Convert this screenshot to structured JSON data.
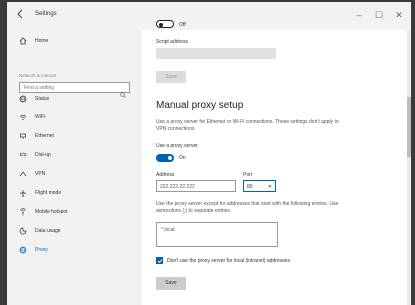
{
  "window": {
    "title": "Settings",
    "controls": {
      "minimize": "–",
      "maximize": "☐",
      "close": "✕"
    }
  },
  "sidebar": {
    "home_label": "Home",
    "search_placeholder": "Find a setting",
    "section_label": "Network & Internet",
    "items": [
      {
        "label": "Status",
        "icon": "globe-icon"
      },
      {
        "label": "WiFi",
        "icon": "wifi-icon"
      },
      {
        "label": "Ethernet",
        "icon": "ethernet-icon"
      },
      {
        "label": "Dial-up",
        "icon": "dialup-icon"
      },
      {
        "label": "VPN",
        "icon": "vpn-icon"
      },
      {
        "label": "Flight mode",
        "icon": "airplane-icon"
      },
      {
        "label": "Mobile hotspot",
        "icon": "hotspot-icon"
      },
      {
        "label": "Data usage",
        "icon": "data-usage-icon"
      },
      {
        "label": "Proxy",
        "icon": "globe-icon",
        "active": true
      }
    ]
  },
  "main": {
    "auto_toggle_state": "Off",
    "script_address_label": "Script address",
    "script_save_label": "Save",
    "manual_heading": "Manual proxy setup",
    "manual_desc": "Use a proxy server for Ethernet or Wi-Fi connections. These settings don't apply to VPN connections.",
    "use_proxy_label": "Use a proxy server",
    "use_proxy_state": "On",
    "address_label": "Address",
    "address_value": "222.222.22.222",
    "port_label": "Port",
    "port_value": "80",
    "exceptions_desc": "Use the proxy server except for addresses that start with the following entries. Use semicolons (;) to separate entries.",
    "exceptions_value": "*.local",
    "bypass_local_label": "Don't use the proxy server for local (intranet) addresses",
    "save_label": "Save"
  },
  "colors": {
    "accent": "#0063b1",
    "sidebar_bg": "#f2f2f2",
    "backdrop": "#3a3a3a"
  }
}
